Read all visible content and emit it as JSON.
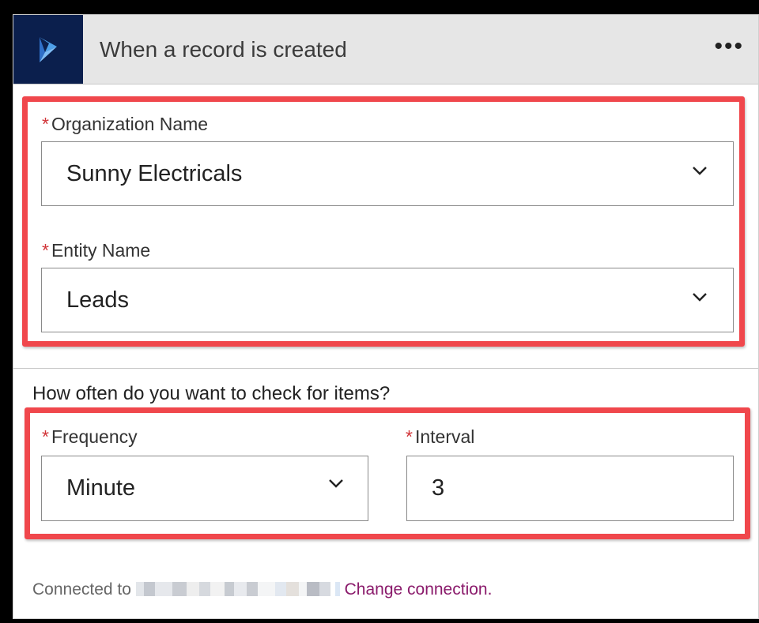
{
  "header": {
    "title": "When a record is created",
    "more_label": "•••",
    "logo_icon": "dynamics-logo-icon",
    "logo_bg": "#0b1f4d"
  },
  "required_mark": "*",
  "fields": {
    "organization": {
      "label": "Organization Name",
      "value": "Sunny Electricals"
    },
    "entity": {
      "label": "Entity Name",
      "value": "Leads"
    },
    "frequency": {
      "label": "Frequency",
      "value": "Minute"
    },
    "interval": {
      "label": "Interval",
      "value": "3"
    }
  },
  "schedule": {
    "question": "How often do you want to check for items?"
  },
  "footer": {
    "connected_prefix": "Connected to",
    "change_link": "Change connection."
  },
  "colors": {
    "highlight": "#f0474c",
    "required": "#d13438",
    "link": "#8a1a6b"
  }
}
